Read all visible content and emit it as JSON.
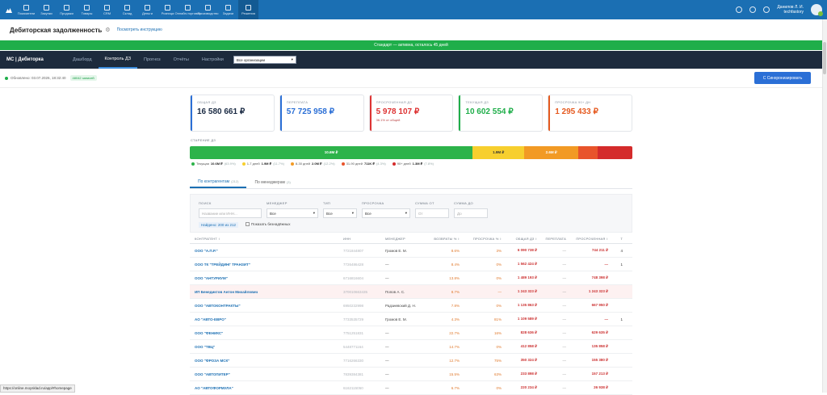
{
  "nav": {
    "items": [
      {
        "label": "Показатели",
        "icon": "chart-icon"
      },
      {
        "label": "Закупки",
        "icon": "cart-icon"
      },
      {
        "label": "Продажи",
        "icon": "bag-icon"
      },
      {
        "label": "Товары",
        "icon": "box-icon"
      },
      {
        "label": "CRM",
        "icon": "people-icon"
      },
      {
        "label": "Склад",
        "icon": "warehouse-icon"
      },
      {
        "label": "Деньги",
        "icon": "money-icon"
      },
      {
        "label": "Розница",
        "icon": "store-icon"
      },
      {
        "label": "Онлайн-торговля",
        "icon": "globe-icon"
      },
      {
        "label": "Производство",
        "icon": "factory-icon"
      },
      {
        "label": "Задачи",
        "icon": "tasks-icon"
      },
      {
        "label": "Решения",
        "icon": "solutions-icon"
      }
    ],
    "active_index": 11,
    "user_name": "Данилов Л. И.",
    "user_company": "techfastory"
  },
  "header": {
    "title": "Дебиторская задолженность",
    "help_link": "Посмотреть инструкцию"
  },
  "banner": "Стандарт — активна, осталось 45 дней",
  "subnav": {
    "brand": "МС | Дебиторка",
    "tabs": [
      "Дашборд",
      "Контроль ДЗ",
      "Прогноз",
      "Отчёты",
      "Настройки"
    ],
    "active_tab": 1,
    "org_select": "Все организации"
  },
  "info": {
    "updated": "Обновлено: 03.07.2026, 18:32:40",
    "count": "48042 записей",
    "sync_button": "С Синхронизировать"
  },
  "cards": [
    {
      "label": "ОБЩАЯ ДЗ",
      "value": "16 580 661 ₽",
      "color": "#1b2b44",
      "accent": "#2b6fd6",
      "sub": ""
    },
    {
      "label": "ПЕРЕПЛАТА",
      "value": "57 725 958 ₽",
      "color": "#2b6fd6",
      "accent": "#2b6fd6",
      "sub": ""
    },
    {
      "label": "ПРОСРОЧЕННАЯ ДЗ",
      "value": "5 978 107 ₽",
      "color": "#d33",
      "accent": "#d33",
      "sub": "36.1% от общей"
    },
    {
      "label": "ТЕКУЩАЯ ДЗ",
      "value": "10 602 554 ₽",
      "color": "#1fae4a",
      "accent": "#1fae4a",
      "sub": ""
    },
    {
      "label": "ПРОСРОЧКА 90+ ДН",
      "value": "1 295 433 ₽",
      "color": "#e55a20",
      "accent": "#e55a20",
      "sub": ""
    }
  ],
  "aging": {
    "label": "СТАРЕНИЕ ДЗ",
    "segments": [
      {
        "text": "10.6M ₽",
        "share": 0.639,
        "color": "#2db34a"
      },
      {
        "text": "1.9M ₽",
        "share": 0.117,
        "color": "#f7cf2e"
      },
      {
        "text": "2.6M ₽",
        "share": 0.122,
        "color": "#f29a24"
      },
      {
        "text": "",
        "share": 0.043,
        "color": "#e8542b"
      },
      {
        "text": "",
        "share": 0.079,
        "color": "#d42b2b"
      }
    ],
    "legend": [
      {
        "name": "Текущая",
        "amount": "10.6M ₽",
        "pct": "(63.9%)",
        "color": "#2db34a"
      },
      {
        "name": "1-7 дней",
        "amount": "1.9M ₽",
        "pct": "(11.7%)",
        "color": "#f7cf2e"
      },
      {
        "name": "8-30 дней",
        "amount": "2.0M ₽",
        "pct": "(12.2%)",
        "color": "#f29a24"
      },
      {
        "name": "31-90 дней",
        "amount": "711K ₽",
        "pct": "(4.3%)",
        "color": "#e8542b"
      },
      {
        "name": "90+ дней",
        "amount": "1.3M ₽",
        "pct": "(7.8%)",
        "color": "#d42b2b"
      }
    ]
  },
  "detail_tabs": [
    {
      "label": "По контрагентам",
      "count": "(212)"
    },
    {
      "label": "По менеджерам",
      "count": "(3)"
    }
  ],
  "filters": {
    "search_label": "ПОИСК",
    "search_placeholder": "Название или ИНН...",
    "manager_label": "МЕНЕДЖЕР",
    "manager_value": "Все",
    "type_label": "ТИП",
    "type_value": "Все",
    "overdue_label": "ПРОСРОЧКА",
    "overdue_value": "Все",
    "sum_from_label": "СУММА ОТ",
    "sum_from_placeholder": "От",
    "sum_to_label": "СУММА ДО",
    "sum_to_placeholder": "До",
    "found": "Найдено: 200 из 212",
    "show_no_debt": "Показать безнадёжных"
  },
  "table": {
    "headers": [
      "КОНТРАГЕНТ ↕",
      "ИНН",
      "МЕНЕДЖЕР",
      "ВОЗВРАТЫ % ↕",
      "ПРОСРОЧКА % ↕",
      "ОБЩАЯ ДЗ ↕",
      "ПЕРЕПЛАТА",
      "ПРОСРОЧЕННАЯ ↕",
      "Т"
    ],
    "rows": [
      {
        "name": "ООО \"А.П.Р.\"",
        "inn": "7721844807",
        "mgr": "Громов Е. М.",
        "ret": "8.6%",
        "ovd": "3%",
        "total": "6 090 738 ₽",
        "over": "—",
        "overdue": "744 211 ₽",
        "t": "4",
        "hl": false
      },
      {
        "name": "ООО ТК \"ТРЕЙДИНГ ТРАНЗИТ\"",
        "inn": "7726486428",
        "mgr": "—",
        "ret": "8.4%",
        "ovd": "0%",
        "total": "1 562 424 ₽",
        "over": "—",
        "overdue": "—",
        "t": "1",
        "hl": false
      },
      {
        "name": "ООО \"АНТУРИУМ\"",
        "inn": "6716816604",
        "mgr": "—",
        "ret": "13.8%",
        "ovd": "0%",
        "total": "1 489 193 ₽",
        "over": "—",
        "overdue": "748 398 ₽",
        "t": "",
        "hl": false
      },
      {
        "name": "ИП Бенедиктов Антон Михайлович",
        "inn": "370010663435",
        "mgr": "Попов А. С.",
        "ret": "8.7%",
        "ovd": "—",
        "total": "1 243 323 ₽",
        "over": "—",
        "overdue": "1 243 323 ₽",
        "t": "",
        "hl": true
      },
      {
        "name": "ООО \"АВТОКОНТРАКТЫ\"",
        "inn": "6950232998",
        "mgr": "Радзиевский Д. Н.",
        "ret": "7.8%",
        "ovd": "0%",
        "total": "1 135 863 ₽",
        "over": "—",
        "overdue": "667 950 ₽",
        "t": "",
        "hl": false
      },
      {
        "name": "АО \"АВТО-ЕВРО\"",
        "inn": "7733535729",
        "mgr": "Громов Е. М.",
        "ret": "4.3%",
        "ovd": "81%",
        "total": "1 109 589 ₽",
        "over": "—",
        "overdue": "—",
        "t": "1",
        "hl": false
      },
      {
        "name": "ООО \"ФЕНИКС\"",
        "inn": "7751251831",
        "mgr": "—",
        "ret": "22.7%",
        "ovd": "16%",
        "total": "828 636 ₽",
        "over": "—",
        "overdue": "629 635 ₽",
        "t": "",
        "hl": false
      },
      {
        "name": "ООО \"ТВЦ\"",
        "inn": "5448771164",
        "mgr": "—",
        "ret": "14.7%",
        "ovd": "0%",
        "total": "412 858 ₽",
        "over": "—",
        "overdue": "135 858 ₽",
        "t": "",
        "hl": false
      },
      {
        "name": "ООО \"ФРОЗА МСК\"",
        "inn": "7716266330",
        "mgr": "—",
        "ret": "12.7%",
        "ovd": "75%",
        "total": "350 324 ₽",
        "over": "—",
        "overdue": "155 380 ₽",
        "t": "",
        "hl": false
      },
      {
        "name": "ООО \"АВТОПИТЕР\"",
        "inn": "7839384381",
        "mgr": "—",
        "ret": "15.5%",
        "ovd": "63%",
        "total": "233 898 ₽",
        "over": "—",
        "overdue": "157 213 ₽",
        "t": "",
        "hl": false
      },
      {
        "name": "АО \"АВТОФОРМУЛА\"",
        "inn": "6162115050",
        "mgr": "—",
        "ret": "6.7%",
        "ovd": "0%",
        "total": "220 234 ₽",
        "over": "—",
        "overdue": "26 938 ₽",
        "t": "",
        "hl": false
      }
    ]
  },
  "status_url": "https://online.moysklad.ru/app/#homepage"
}
